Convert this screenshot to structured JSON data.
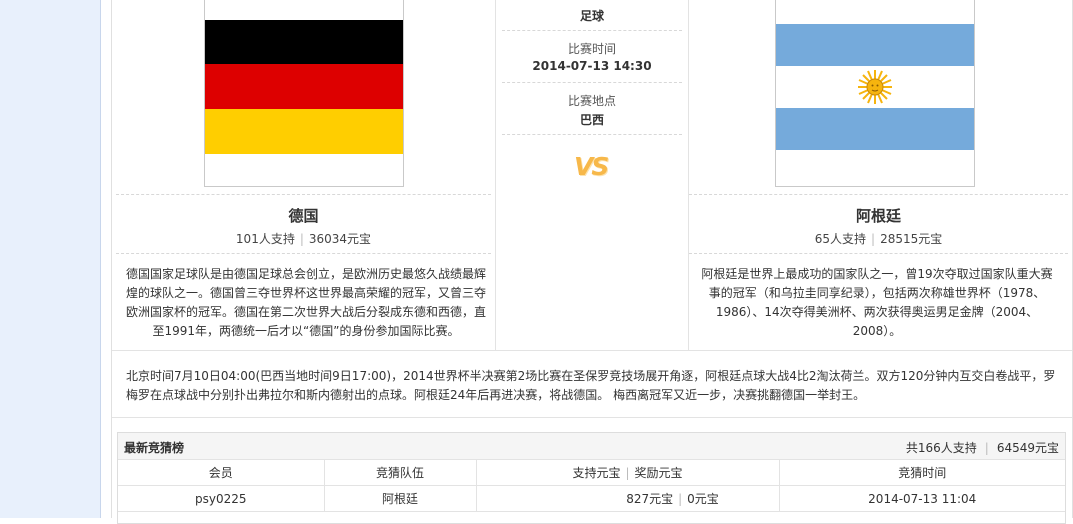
{
  "match": {
    "sport": "足球",
    "time_label": "比赛时间",
    "time_value": "2014-07-13 14:30",
    "venue_label": "比赛地点",
    "venue_value": "巴西",
    "vs_text": "VS"
  },
  "home": {
    "name": "德国",
    "supporters": "101人支持",
    "yuanbao": "36034元宝",
    "flag_colors": [
      "#000000",
      "#dd0000",
      "#ffce00"
    ],
    "description": "德国国家足球队是由德国足球总会创立，是欧洲历史最悠久战绩最辉煌的球队之一。德国曾三夺世界杯这世界最高荣耀的冠军，又曾三夺欧洲国家杯的冠军。德国在第二次世界大战后分裂成东德和西德，直至1991年，两德统一后才以“德国”的身份参加国际比赛。"
  },
  "away": {
    "name": "阿根廷",
    "supporters": "65人支持",
    "yuanbao": "28515元宝",
    "flag_colors": [
      "#75aadb",
      "#ffffff",
      "#f6b40e"
    ],
    "description": "阿根廷是世界上最成功的国家队之一，曾19次夺取过国家队重大赛事的冠军（和乌拉圭同享纪录），包括两次称雄世界杯（1978、1986）、14次夺得美洲杯、两次获得奥运男足金牌（2004、2008）。"
  },
  "summary": "北京时间7月10日04:00(巴西当地时间9日17:00)，2014世界杯半决赛第2场比赛在圣保罗竞技场展开角逐，阿根廷点球大战4比2淘汰荷兰。双方120分钟内互交白卷战平，罗梅罗在点球战中分别扑出弗拉尔和斯内德射出的点球。阿根廷24年后再进决赛，将战德国。 梅西离冠军又近一步，决赛挑翻德国一举封王。",
  "ranking": {
    "title": "最新竞猜榜",
    "total_people": "共166人支持",
    "total_yuanbao": "64549元宝",
    "columns": {
      "member": "会员",
      "team": "竞猜队伍",
      "support": "支持元宝",
      "reward": "奖励元宝",
      "time": "竞猜时间"
    },
    "rows": [
      {
        "member": "psy0225",
        "team": "阿根廷",
        "support": "827元宝",
        "reward": "0元宝",
        "time": "2014-07-13 11:04"
      }
    ]
  }
}
